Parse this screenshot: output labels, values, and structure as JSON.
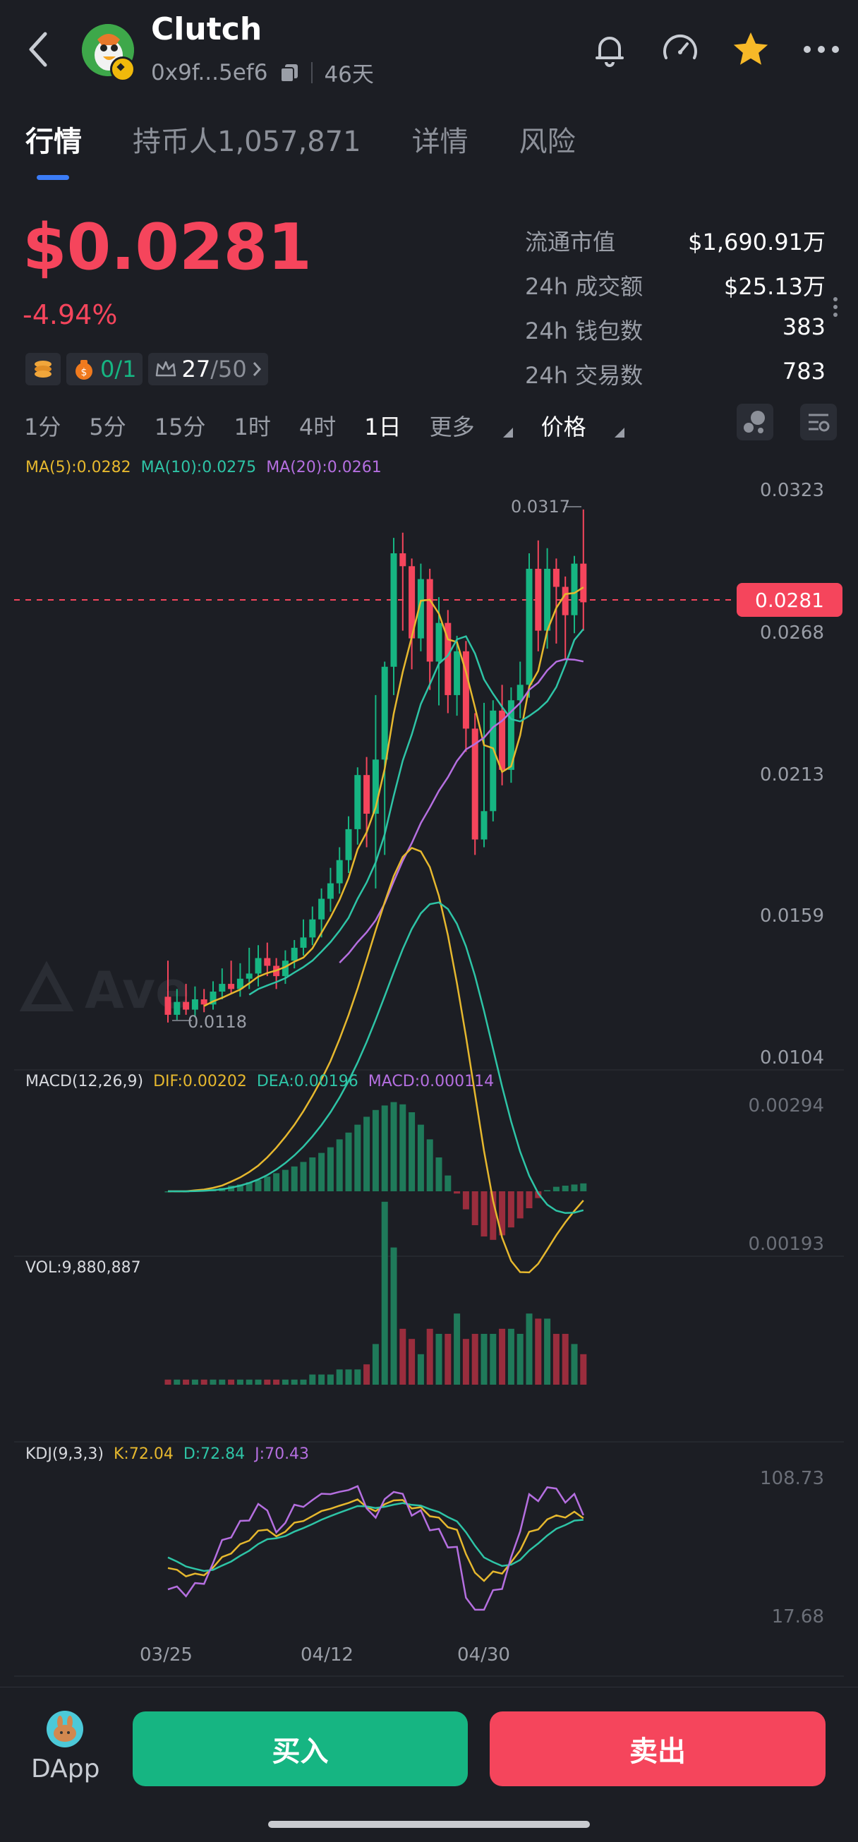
{
  "header": {
    "title": "Clutch",
    "address": "0x9f...5ef6",
    "age": "46天"
  },
  "tabs": [
    "行情",
    "持币人1,057,871",
    "详情",
    "风险"
  ],
  "price": {
    "value": "$0.0281",
    "change": "-4.94%",
    "chip_ratio": "0/1",
    "chip_score_a": "27",
    "chip_score_b": "/50"
  },
  "stats": [
    {
      "label": "流通市值",
      "value": "$1,690.91万"
    },
    {
      "label": "24h 成交额",
      "value": "$25.13万"
    },
    {
      "label": "24h 钱包数",
      "value": "383"
    },
    {
      "label": "24h 交易数",
      "value": "783"
    }
  ],
  "timeframes": [
    "1分",
    "5分",
    "15分",
    "1时",
    "4时",
    "1日",
    "更多",
    "价格"
  ],
  "selected_timeframe": "1日",
  "indicators": {
    "ma": [
      "MA(5):0.0282",
      "MA(10):0.0275",
      "MA(20):0.0261"
    ],
    "macd": [
      "MACD(12,26,9)",
      "DIF:0.00202",
      "DEA:0.00196",
      "MACD:0.000114"
    ],
    "vol": "VOL:9,880,887",
    "kdj": [
      "KDJ(9,3,3)",
      "K:72.04",
      "D:72.84",
      "J:70.43"
    ]
  },
  "colors": {
    "up": "#16b582",
    "down": "#f5455c",
    "ma5": "#e6b82e",
    "ma10": "#2ec4a6",
    "ma20": "#b56fe0",
    "accent": "#3b7cf6"
  },
  "chart_data": {
    "type": "candlestick",
    "price_axis": [
      "0.0323",
      "0.0268",
      "0.0213",
      "0.0159",
      "0.0104"
    ],
    "current_price_tag": "0.0281",
    "high_label": "0.0317",
    "low_label": "0.0118",
    "macd_axis": [
      "0.00294",
      "0.00193"
    ],
    "kdj_axis": [
      "108.73",
      "17.68"
    ],
    "x_labels": [
      "03/25",
      "04/12",
      "04/30"
    ],
    "candles": [
      [
        0.0128,
        0.0121,
        0.0142,
        0.0118
      ],
      [
        0.0121,
        0.0126,
        0.0131,
        0.0119
      ],
      [
        0.0126,
        0.0123,
        0.0133,
        0.0121
      ],
      [
        0.0123,
        0.0127,
        0.0132,
        0.012
      ],
      [
        0.0127,
        0.0125,
        0.0131,
        0.0122
      ],
      [
        0.0125,
        0.013,
        0.0134,
        0.0123
      ],
      [
        0.013,
        0.0133,
        0.0139,
        0.0127
      ],
      [
        0.0133,
        0.0131,
        0.0142,
        0.0129
      ],
      [
        0.0131,
        0.0135,
        0.0141,
        0.0128
      ],
      [
        0.0135,
        0.0137,
        0.0147,
        0.0131
      ],
      [
        0.0137,
        0.0143,
        0.0148,
        0.0132
      ],
      [
        0.0143,
        0.014,
        0.0149,
        0.0136
      ],
      [
        0.014,
        0.0136,
        0.0143,
        0.0131
      ],
      [
        0.0136,
        0.0142,
        0.0146,
        0.0133
      ],
      [
        0.0142,
        0.0147,
        0.015,
        0.0139
      ],
      [
        0.0147,
        0.0151,
        0.0158,
        0.0144
      ],
      [
        0.0151,
        0.0158,
        0.0163,
        0.0148
      ],
      [
        0.0158,
        0.0166,
        0.017,
        0.0151
      ],
      [
        0.0166,
        0.0172,
        0.0178,
        0.0161
      ],
      [
        0.0172,
        0.0181,
        0.0186,
        0.0168
      ],
      [
        0.0181,
        0.0193,
        0.0198,
        0.0176
      ],
      [
        0.0193,
        0.0214,
        0.0217,
        0.0187
      ],
      [
        0.0214,
        0.0199,
        0.0221,
        0.0186
      ],
      [
        0.0199,
        0.022,
        0.0245,
        0.017
      ],
      [
        0.022,
        0.0256,
        0.0258,
        0.0183
      ],
      [
        0.0256,
        0.03,
        0.0306,
        0.0245
      ],
      [
        0.03,
        0.0295,
        0.0308,
        0.027
      ],
      [
        0.0295,
        0.0267,
        0.0298,
        0.0255
      ],
      [
        0.0267,
        0.029,
        0.0296,
        0.0262
      ],
      [
        0.029,
        0.0258,
        0.0294,
        0.0247
      ],
      [
        0.0258,
        0.0273,
        0.0283,
        0.0241
      ],
      [
        0.0273,
        0.0245,
        0.0278,
        0.0238
      ],
      [
        0.0245,
        0.0262,
        0.0268,
        0.0237
      ],
      [
        0.0262,
        0.0232,
        0.0266,
        0.0223
      ],
      [
        0.0232,
        0.0189,
        0.0238,
        0.0183
      ],
      [
        0.0189,
        0.02,
        0.0242,
        0.0186
      ],
      [
        0.02,
        0.0239,
        0.0243,
        0.0196
      ],
      [
        0.0239,
        0.0216,
        0.0249,
        0.021
      ],
      [
        0.0216,
        0.0243,
        0.0248,
        0.0211
      ],
      [
        0.0243,
        0.0249,
        0.0258,
        0.0236
      ],
      [
        0.0249,
        0.0294,
        0.03,
        0.0244
      ],
      [
        0.0294,
        0.027,
        0.0305,
        0.0262
      ],
      [
        0.027,
        0.0294,
        0.0302,
        0.0263
      ],
      [
        0.0294,
        0.0287,
        0.0298,
        0.0265
      ],
      [
        0.0287,
        0.0276,
        0.0291,
        0.0259
      ],
      [
        0.0276,
        0.0296,
        0.0299,
        0.0269
      ],
      [
        0.0296,
        0.0281,
        0.0317,
        0.027
      ]
    ],
    "volume": [
      1,
      1,
      1,
      1,
      1,
      1,
      1,
      1,
      1,
      1,
      1,
      1,
      1,
      1,
      1,
      1,
      2,
      2,
      2,
      3,
      3,
      3,
      4,
      8,
      36,
      27,
      11,
      9,
      6,
      11,
      10,
      10,
      14,
      9,
      10,
      10,
      10,
      11,
      11,
      10,
      14,
      13,
      13,
      10,
      10,
      8,
      6
    ],
    "macd_hist": [
      0,
      0,
      0,
      0.1,
      0.1,
      0.2,
      0.3,
      0.5,
      0.6,
      0.8,
      1.0,
      1.3,
      1.6,
      1.9,
      2.2,
      2.6,
      3.0,
      3.4,
      3.9,
      4.6,
      5.2,
      5.9,
      6.6,
      7.2,
      7.6,
      7.9,
      7.7,
      7.0,
      5.9,
      4.6,
      3.0,
      1.4,
      -0.2,
      -1.6,
      -3.0,
      -4.0,
      -4.3,
      -3.9,
      -3.2,
      -2.4,
      -1.5,
      -0.6,
      0.1,
      0.4,
      0.5,
      0.6,
      0.7
    ]
  }
}
